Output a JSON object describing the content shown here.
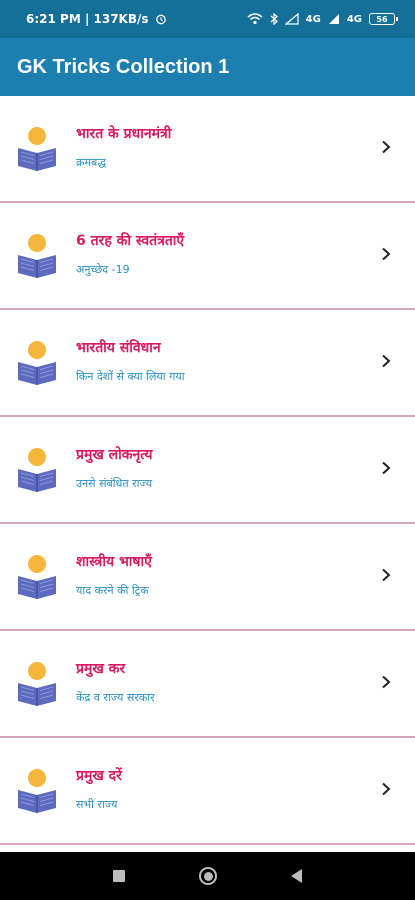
{
  "status_bar": {
    "time_speed": "6:21 PM | 137KB/s",
    "network_1": "4G",
    "network_2": "4G",
    "battery": "56"
  },
  "app_bar": {
    "title": "GK Tricks Collection 1"
  },
  "items": [
    {
      "title": "भारत के प्रधानमंत्री",
      "subtitle": "क्रमबद्ध"
    },
    {
      "title": "6 तरह की स्वतंत्रताएँ",
      "subtitle": "अनुच्छेद -19"
    },
    {
      "title": "भारतीय संविधान",
      "subtitle": "किन देशों से क्या लिया गया"
    },
    {
      "title": "प्रमुख लोकनृत्य",
      "subtitle": "उनसे संबंधित राज्य"
    },
    {
      "title": "शास्त्रीय भाषाएँ",
      "subtitle": "याद करने की ट्रिक"
    },
    {
      "title": "प्रमुख कर",
      "subtitle": "केंद्र व राज्य सरकार"
    },
    {
      "title": "प्रमुख दरें",
      "subtitle": "सभी राज्य"
    }
  ],
  "colors": {
    "status_bar": "#146f99",
    "app_bar": "#1c7fb0",
    "title_text": "#d81b60",
    "subtitle_text": "#2a8fc2",
    "divider": "#d4a6bd",
    "icon_head": "#f5b73b",
    "icon_book": "#5c6bc0"
  },
  "icons": {
    "item_icon": "reader-book-icon",
    "item_chevron": "chevron-right-icon"
  }
}
